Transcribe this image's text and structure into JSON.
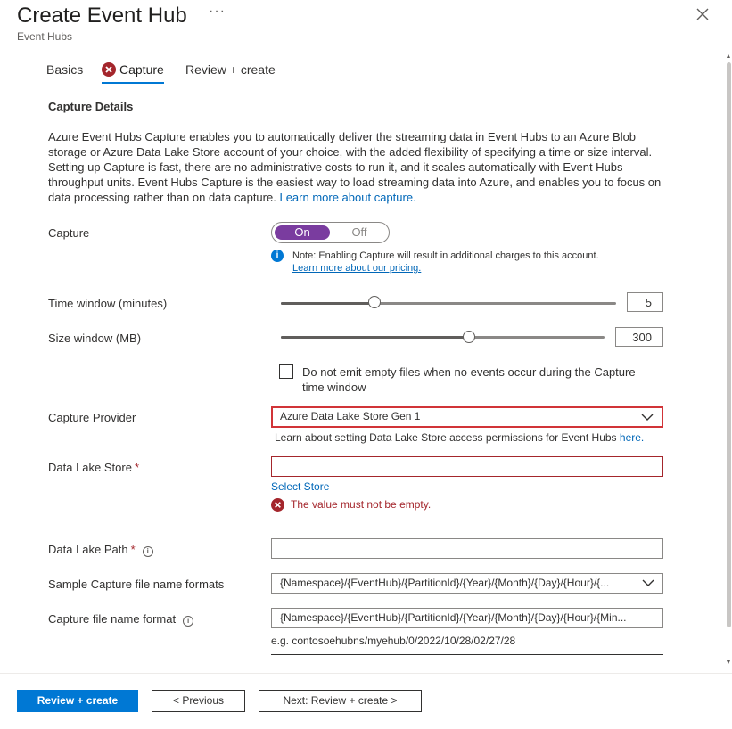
{
  "header": {
    "title": "Create Event Hub",
    "more": "···",
    "subtitle": "Event Hubs"
  },
  "tabs": {
    "basics": "Basics",
    "capture": "Capture",
    "review": "Review + create"
  },
  "section": {
    "title": "Capture Details",
    "description": "Azure Event Hubs Capture enables you to automatically deliver the streaming data in Event Hubs to an Azure Blob storage or Azure Data Lake Store account of your choice, with the added flexibility of specifying a time or size interval. Setting up Capture is fast, there are no administrative costs to run it, and it scales automatically with Event Hubs throughput units. Event Hubs Capture is the easiest way to load streaming data into Azure, and enables you to focus on data processing rather than on data capture.",
    "learn_more": "Learn more about capture."
  },
  "capture": {
    "label": "Capture",
    "on_label": "On",
    "off_label": "Off",
    "note": "Note: Enabling Capture will result in additional charges to this account.",
    "pricing_link": "Learn more about our pricing."
  },
  "time_window": {
    "label": "Time window (minutes)",
    "value": "5",
    "fraction": 0.28
  },
  "size_window": {
    "label": "Size window (MB)",
    "value": "300",
    "fraction": 0.58
  },
  "empty_files": {
    "label": "Do not emit empty files when no events occur during the Capture time window",
    "checked": false
  },
  "provider": {
    "label": "Capture Provider",
    "value": "Azure Data Lake Store Gen 1",
    "help": "Learn about setting Data Lake Store access permissions for Event Hubs",
    "help_link": "here."
  },
  "store": {
    "label": "Data Lake Store",
    "required": "*",
    "value": "",
    "select_link": "Select Store",
    "error": "The value must not be empty."
  },
  "path": {
    "label": "Data Lake Path",
    "required": "*",
    "value": ""
  },
  "sample_formats": {
    "label": "Sample Capture file name formats",
    "value": "{Namespace}/{EventHub}/{PartitionId}/{Year}/{Month}/{Day}/{Hour}/{..."
  },
  "file_format": {
    "label": "Capture file name format",
    "value": "{Namespace}/{EventHub}/{PartitionId}/{Year}/{Month}/{Day}/{Hour}/{Min...",
    "example": "e.g. contosoehubns/myehub/0/2022/10/28/02/27/28"
  },
  "footer": {
    "review_create": "Review + create",
    "previous": "< Previous",
    "next": "Next: Review + create >"
  },
  "colors": {
    "primary": "#0078d4",
    "toggle_on": "#7a3c9f",
    "error": "#a4262c",
    "highlight_border": "#d13438"
  }
}
